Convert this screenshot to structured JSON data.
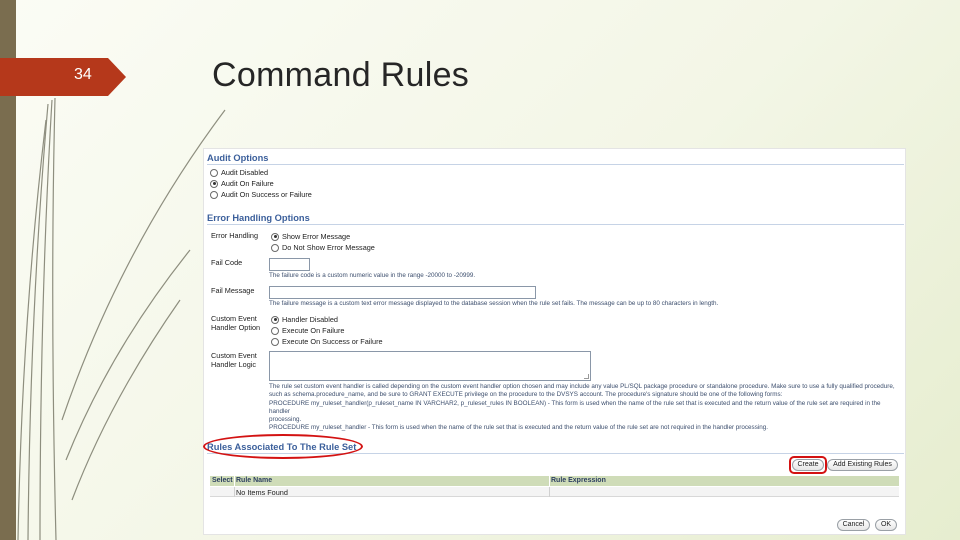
{
  "slide": {
    "number": "34",
    "title": "Command Rules"
  },
  "audit": {
    "title": "Audit Options",
    "options": [
      "Audit Disabled",
      "Audit On Failure",
      "Audit On Success or Failure"
    ],
    "selected": "Audit On Failure"
  },
  "error_handling": {
    "title": "Error Handling Options",
    "error_handling_label": "Error Handling",
    "error_options": [
      "Show Error Message",
      "Do Not Show Error Message"
    ],
    "error_selected": "Show Error Message",
    "fail_code_label": "Fail Code",
    "fail_code_value": "",
    "fail_code_help": "The failure code is a custom numeric value in the range -20000 to -20999.",
    "fail_message_label": "Fail Message",
    "fail_message_value": "",
    "fail_message_help": "The failure message is a custom text error message displayed to the database session when the rule set fails. The message can be up to 80 characters in length.",
    "custom_event_option_label_1": "Custom Event",
    "custom_event_option_label_2": "Handler Option",
    "handler_options": [
      "Handler Disabled",
      "Execute On Failure",
      "Execute On Success or Failure"
    ],
    "handler_selected": "Handler Disabled",
    "custom_event_logic_label_1": "Custom Event",
    "custom_event_logic_label_2": "Handler Logic",
    "custom_event_logic_value": "",
    "logic_help_1": "The rule set custom event handler is called depending on the custom event handler option chosen and may include any value PL/SQL package procedure or standalone procedure. Make sure to use a fully qualified procedure,",
    "logic_help_2": "such as schema.procedure_name, and be sure to GRANT EXECUTE privilege on the procedure to the DVSYS account. The procedure's signature should be one of the following forms:",
    "logic_help_3": "PROCEDURE my_ruleset_handler(p_ruleset_name IN VARCHAR2, p_ruleset_rules IN BOOLEAN) - This form is used when the name of the rule set that is executed and the return value of the rule set are required in the handler",
    "logic_help_4": "processing.",
    "logic_help_5": "PROCEDURE my_ruleset_handler - This form is used when the name of the rule set that is executed and the return value of the rule set are not required in the handler processing."
  },
  "rules": {
    "title": "Rules Associated To The Rule Set",
    "create_label": "Create",
    "add_existing_label": "Add Existing Rules",
    "columns": [
      "Select",
      "Rule Name",
      "Rule Expression"
    ],
    "empty_text": "No Items Found"
  },
  "footer": {
    "cancel_label": "Cancel",
    "ok_label": "OK"
  },
  "colors": {
    "accent": "#b5381b",
    "section_title": "#3b5f9b",
    "highlight": "#d31212",
    "table_header": "#cfdcb8"
  }
}
